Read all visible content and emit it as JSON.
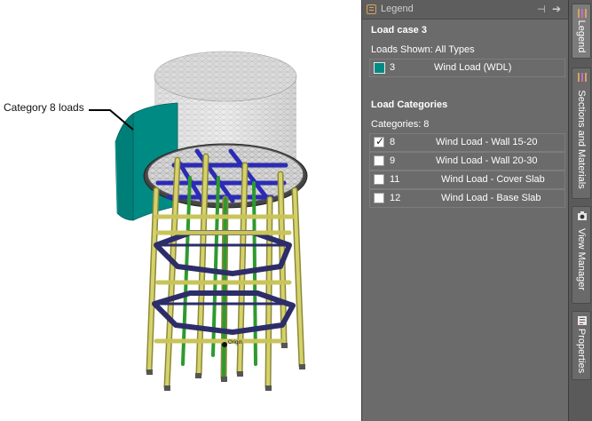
{
  "viewport": {
    "callout_label": "Category 8 loads",
    "origin_label": "Origin"
  },
  "legend": {
    "title": "Legend",
    "load_case_title": "Load case 3",
    "loads_shown": "Loads Shown: All Types",
    "load_case_row": {
      "number": "3",
      "name": "Wind Load (WDL)",
      "color": "#008a84"
    },
    "categories_title": "Load Categories",
    "categories_count": "Categories: 8",
    "categories": [
      {
        "number": "8",
        "name": "Wind Load - Wall 15-20",
        "checked": true
      },
      {
        "number": "9",
        "name": "Wind Load - Wall 20-30",
        "checked": false
      },
      {
        "number": "11",
        "name": "Wind Load - Cover Slab",
        "checked": false
      },
      {
        "number": "12",
        "name": "Wind Load - Base Slab",
        "checked": false
      }
    ]
  },
  "tabs": [
    {
      "label": "Legend",
      "icon": "legend-icon"
    },
    {
      "label": "Sections and Materials",
      "icon": "sections-icon"
    },
    {
      "label": "View Manager",
      "icon": "camera-icon"
    },
    {
      "label": "Properties",
      "icon": "properties-icon"
    }
  ],
  "colors": {
    "panel_bg": "#6b6b6b",
    "wind_load": "#008a84",
    "beam_blue": "#2b2bb5",
    "column_yellow": "#c9c45a",
    "column_green": "#2e9a2e"
  }
}
